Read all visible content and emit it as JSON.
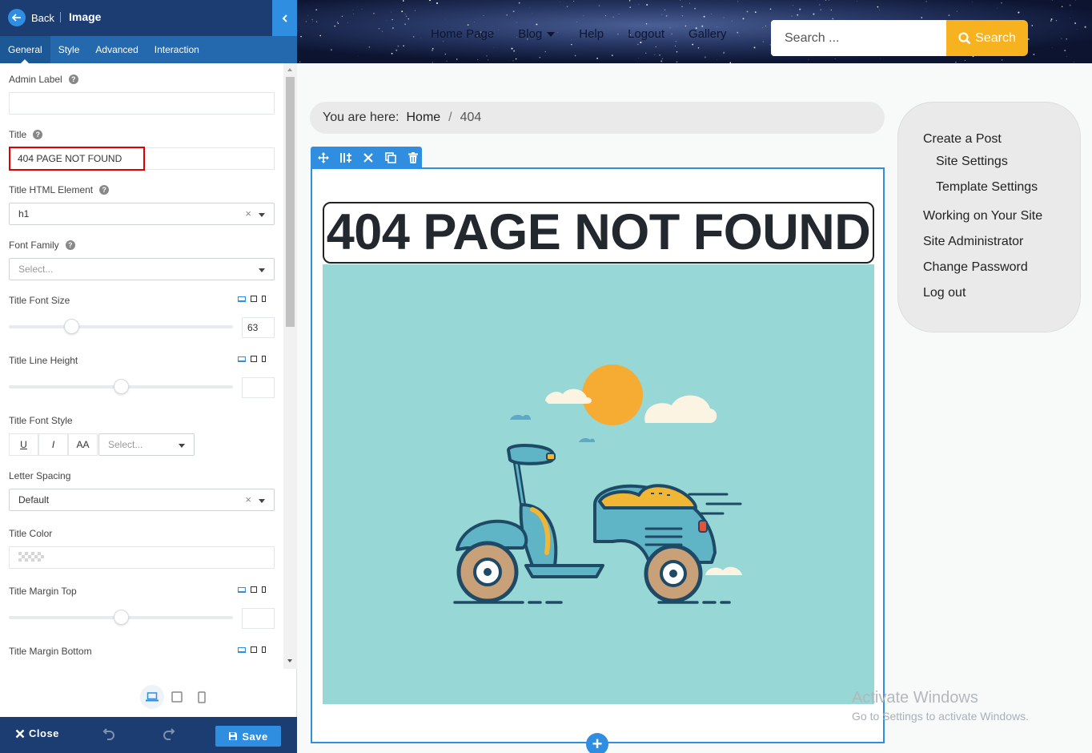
{
  "panel": {
    "back_label": "Back",
    "title": "Image",
    "tabs": [
      {
        "label": "General",
        "active": true
      },
      {
        "label": "Style",
        "active": false
      },
      {
        "label": "Advanced",
        "active": false
      },
      {
        "label": "Interaction",
        "active": false
      }
    ],
    "fields": {
      "admin_label": {
        "label": "Admin Label",
        "value": ""
      },
      "title": {
        "label": "Title",
        "value": "404 PAGE NOT FOUND"
      },
      "title_html_element": {
        "label": "Title HTML Element",
        "value": "h1"
      },
      "font_family": {
        "label": "Font Family",
        "placeholder": "Select..."
      },
      "title_font_size": {
        "label": "Title Font Size",
        "value": "63",
        "slider_fraction": 0.15
      },
      "title_line_height": {
        "label": "Title Line Height",
        "value": "",
        "slider_fraction": 0.5
      },
      "title_font_style": {
        "label": "Title Font Style",
        "buttons": [
          "U",
          "I",
          "AA"
        ],
        "placeholder": "Select..."
      },
      "letter_spacing": {
        "label": "Letter Spacing",
        "value": "Default"
      },
      "title_color": {
        "label": "Title Color"
      },
      "title_margin_top": {
        "label": "Title Margin Top",
        "value": "",
        "slider_fraction": 0.5
      },
      "title_margin_bottom": {
        "label": "Title Margin Bottom"
      }
    },
    "footer": {
      "close_label": "Close",
      "save_label": "Save"
    }
  },
  "site": {
    "nav": [
      {
        "label": "Home Page"
      },
      {
        "label": "Blog",
        "has_dropdown": true
      },
      {
        "label": "Help"
      },
      {
        "label": "Logout"
      },
      {
        "label": "Gallery"
      }
    ],
    "search": {
      "placeholder": "Search ...",
      "button_label": "Search"
    },
    "breadcrumb": {
      "prefix": "You are here:",
      "home": "Home",
      "separator": "/",
      "current": "404"
    },
    "page_title": "404 PAGE NOT FOUND",
    "sidebar_menu": [
      {
        "label": "Create a Post"
      },
      {
        "label": "Site Settings"
      },
      {
        "label": "Template Settings"
      },
      {
        "label": "Working on Your Site"
      },
      {
        "label": "Site Administrator"
      },
      {
        "label": "Change Password"
      },
      {
        "label": "Log out"
      }
    ]
  },
  "watermark": {
    "title": "Activate Windows",
    "subtitle": "Go to Settings to activate Windows."
  },
  "colors": {
    "panel_header": "#1b3d72",
    "panel_tabs": "#2468ae",
    "accent_blue": "#2f8ee0",
    "search_button": "#f6b21f",
    "illustration_bg": "#97d7d6",
    "highlight_red": "#e10000"
  }
}
